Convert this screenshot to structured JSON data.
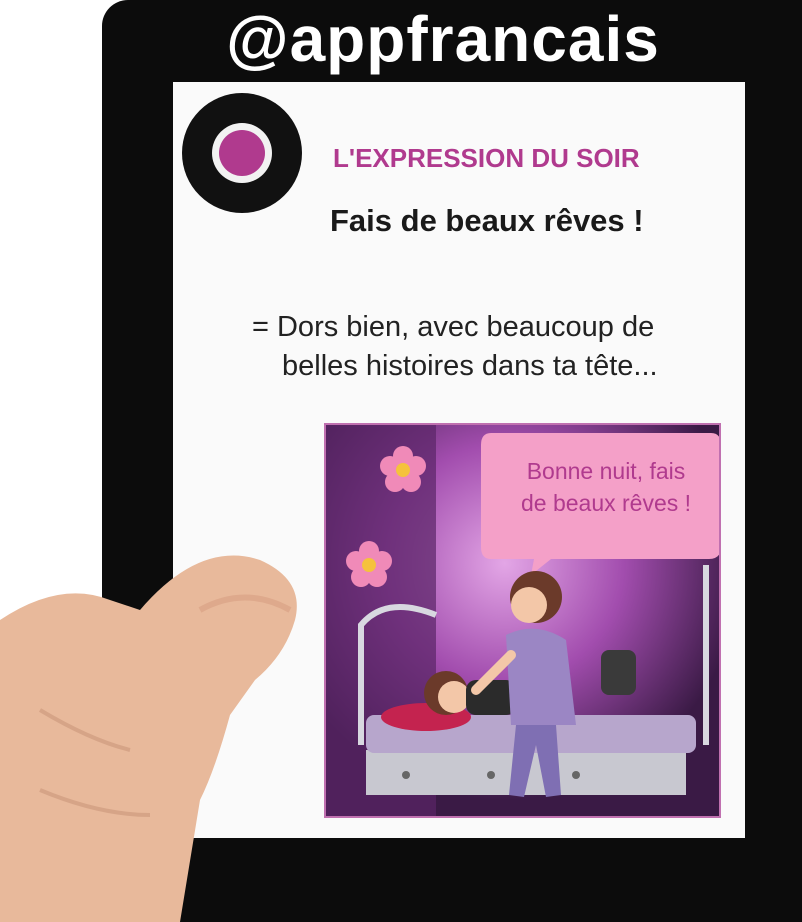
{
  "header": {
    "handle": "@appfrancais"
  },
  "card": {
    "kicker": "L'EXPRESSION DU SOIR",
    "expression": "Fais de beaux rêves !",
    "definition_line1": "= Dors bien, avec beaucoup de",
    "definition_line2": "belles histoires dans ta tête..."
  },
  "illustration": {
    "speech_line1": "Bonne nuit, fais",
    "speech_line2": "de beaux rêves !"
  },
  "colors": {
    "accent": "#b03a8e",
    "bezel": "#0c0c0c",
    "screen": "#fafafa",
    "room": "#7a3a8a"
  }
}
